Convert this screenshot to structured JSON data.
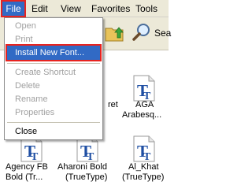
{
  "menubar": {
    "items": [
      {
        "label": "File"
      },
      {
        "label": "Edit"
      },
      {
        "label": "View"
      },
      {
        "label": "Favorites"
      },
      {
        "label": "Tools"
      }
    ]
  },
  "toolbar": {
    "search_label": "Sea"
  },
  "file_menu": {
    "items": [
      {
        "label": "Open",
        "enabled": false
      },
      {
        "label": "Print",
        "enabled": false
      },
      {
        "label": "Install New Font...",
        "enabled": true,
        "highlighted": true
      },
      {
        "label": "Create Shortcut",
        "enabled": false
      },
      {
        "label": "Delete",
        "enabled": false
      },
      {
        "label": "Rename",
        "enabled": false
      },
      {
        "label": "Properties",
        "enabled": false
      },
      {
        "label": "Close",
        "enabled": true
      }
    ]
  },
  "fonts": [
    {
      "line1": "ret",
      "line2": ""
    },
    {
      "line1": "AGA",
      "line2": "Arabesq..."
    },
    {
      "line1": "Agency FB",
      "line2": "Bold (Tr..."
    },
    {
      "line1": "Aharoni Bold",
      "line2": "(TrueType)"
    },
    {
      "line1": "Al_Khat",
      "line2": "(TrueType)"
    }
  ],
  "colors": {
    "menu_highlight": "#316ac5",
    "annotation_red": "#e8231f",
    "font_icon_blue": "#1f4fa3"
  }
}
